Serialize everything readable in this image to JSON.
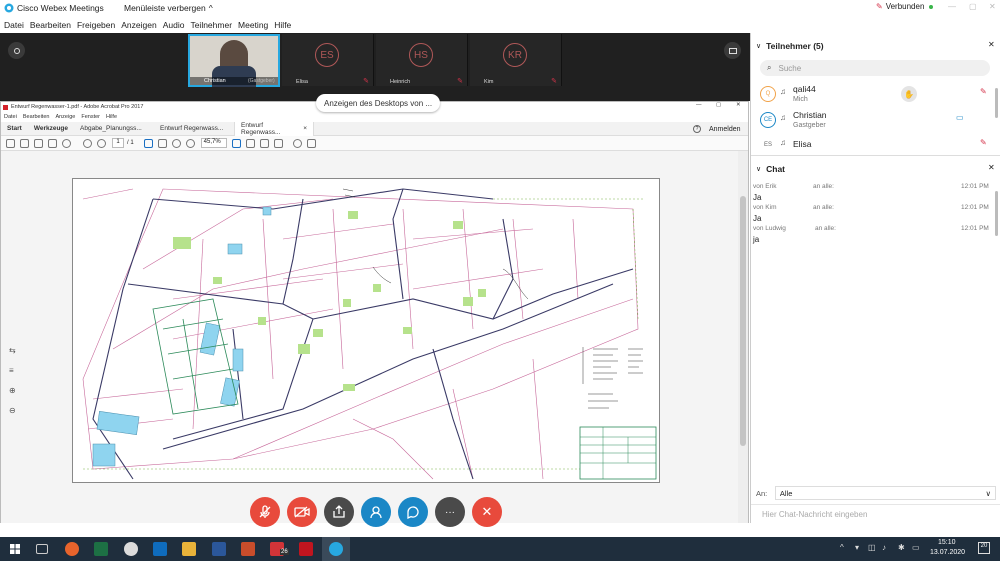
{
  "window": {
    "app_title": "Cisco Webex Meetings",
    "hide_menu_label": "Menüleiste verbergen",
    "connection_status": "Verbunden"
  },
  "menu": {
    "items": [
      "Datei",
      "Bearbeiten",
      "Freigeben",
      "Anzeigen",
      "Audio",
      "Teilnehmer",
      "Meeting",
      "Hilfe"
    ]
  },
  "video_tiles": [
    {
      "name": "Christian",
      "role": "(Gastgeber)"
    },
    {
      "initials": "ES",
      "name": "Elisa"
    },
    {
      "initials": "HS",
      "name": "Heinrich"
    },
    {
      "initials": "KR",
      "name": "Kim"
    }
  ],
  "desktop_pill": "Anzeigen des Desktops von ...",
  "acrobat": {
    "title": "Entwurf Regenwasser-1.pdf - Adobe Acrobat Pro 2017",
    "menu": [
      "Datei",
      "Bearbeiten",
      "Anzeige",
      "Fenster",
      "Hilfe"
    ],
    "tabs": [
      "Start",
      "Werkzeuge",
      "Abgabe_Planungss...",
      "Entwurf Regenwass...",
      "Entwurf Regenwass..."
    ],
    "page_current": "1",
    "page_total": "/ 1",
    "zoom": "45,7%",
    "signin": "Anmelden"
  },
  "participants": {
    "header": "Teilnehmer (5)",
    "search_placeholder": "Suche",
    "list": [
      {
        "initial": "Q",
        "name": "qali44",
        "role": "Mich"
      },
      {
        "initial": "CE",
        "name": "Christian",
        "role": "Gastgeber"
      },
      {
        "initial": "ES",
        "name": "Elisa",
        "role": ""
      }
    ]
  },
  "chat": {
    "header": "Chat",
    "messages": [
      {
        "from": "von Erik",
        "to": "an alle:",
        "time": "12:01 PM",
        "text": "Ja"
      },
      {
        "from": "von Kim",
        "to": "an alle:",
        "time": "12:01 PM",
        "text": "Ja"
      },
      {
        "from": "von Ludwig",
        "to": "an alle:",
        "time": "12:01 PM",
        "text": "ja"
      }
    ],
    "to_label": "An:",
    "to_value": "Alle",
    "input_placeholder": "Hier Chat-Nachricht eingeben"
  },
  "taskbar": {
    "time": "15:10",
    "date": "13.07.2020",
    "badge": "26",
    "notif_count": "20"
  },
  "colors": {
    "end_red": "#e84a3c",
    "share_grey": "#4a4a4a",
    "blue": "#1a87c6",
    "connected_green": "#3ab54a"
  }
}
